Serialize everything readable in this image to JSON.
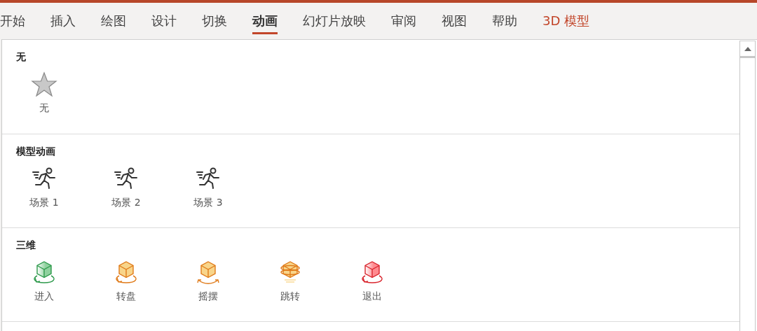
{
  "tabs": [
    {
      "label": "开始",
      "selected": false,
      "kind": "normal"
    },
    {
      "label": "插入",
      "selected": false,
      "kind": "normal"
    },
    {
      "label": "绘图",
      "selected": false,
      "kind": "normal"
    },
    {
      "label": "设计",
      "selected": false,
      "kind": "normal"
    },
    {
      "label": "切换",
      "selected": false,
      "kind": "normal"
    },
    {
      "label": "动画",
      "selected": true,
      "kind": "normal"
    },
    {
      "label": "幻灯片放映",
      "selected": false,
      "kind": "normal"
    },
    {
      "label": "审阅",
      "selected": false,
      "kind": "normal"
    },
    {
      "label": "视图",
      "selected": false,
      "kind": "normal"
    },
    {
      "label": "帮助",
      "selected": false,
      "kind": "normal"
    },
    {
      "label": "3D 模型",
      "selected": false,
      "kind": "contextual"
    }
  ],
  "gallery": {
    "sections": [
      {
        "title": "无",
        "items": [
          {
            "label": "无",
            "kind": "none"
          }
        ]
      },
      {
        "title": "模型动画",
        "items": [
          {
            "label": "场景 1",
            "kind": "runner"
          },
          {
            "label": "场景 2",
            "kind": "runner"
          },
          {
            "label": "场景 3",
            "kind": "runner"
          }
        ]
      },
      {
        "title": "三维",
        "items": [
          {
            "label": "进入",
            "kind": "enter"
          },
          {
            "label": "转盘",
            "kind": "turntable"
          },
          {
            "label": "摇摆",
            "kind": "swing"
          },
          {
            "label": "跳转",
            "kind": "jump"
          },
          {
            "label": "退出",
            "kind": "exit"
          }
        ]
      }
    ]
  }
}
